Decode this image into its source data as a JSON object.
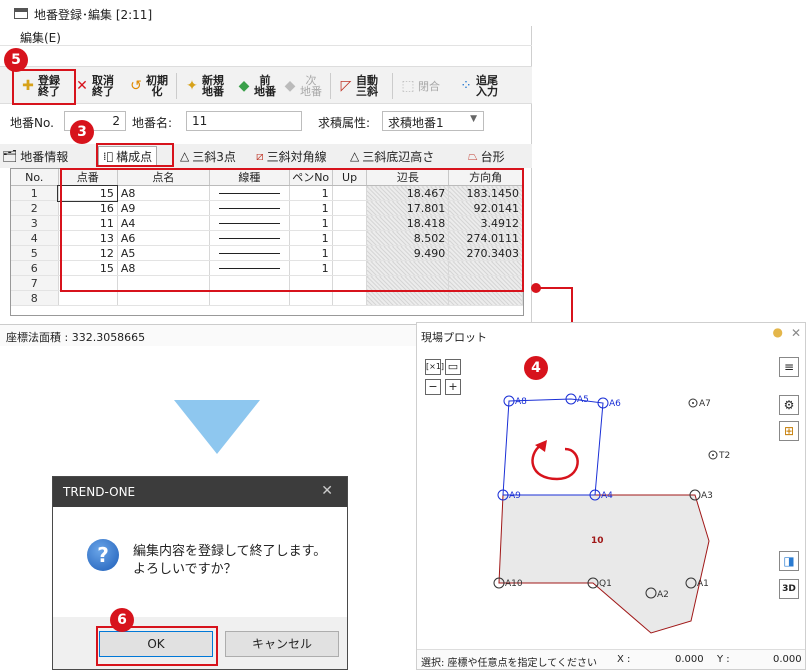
{
  "window": {
    "title": "地番登録･編集 [2:11]",
    "menu_edit": "編集(E)"
  },
  "toolbar": {
    "buttons": [
      {
        "label": "登録\n終了",
        "icon": "register-finish-icon"
      },
      {
        "label": "取消\n終了",
        "icon": "cancel-icon"
      },
      {
        "label": "初期\n化",
        "icon": "reset-icon"
      },
      {
        "label": "新規\n地番",
        "icon": "new-lot-icon"
      },
      {
        "label": "前\n地番",
        "icon": "prev-lot-icon"
      },
      {
        "label": "次\n地番",
        "icon": "next-lot-icon"
      },
      {
        "label": "自動\n三斜",
        "icon": "auto-triangle-icon"
      },
      {
        "label": "閉合",
        "icon": "close-polygon-icon"
      },
      {
        "label": "追尾\n入力",
        "icon": "trace-input-icon"
      }
    ]
  },
  "fields": {
    "lot_no_label": "地番No.",
    "lot_no_value": "2",
    "lot_name_label": "地番名:",
    "lot_name_value": "11",
    "attr_label": "求積属性:",
    "attr_value": "求積地番1"
  },
  "tabs": [
    "地番情報",
    "構成点",
    "三斜3点",
    "三斜対角線",
    "三斜底辺高さ",
    "台形"
  ],
  "grid": {
    "columns": [
      "No.",
      "点番",
      "点名",
      "線種",
      "ペンNo",
      "Up",
      "辺長",
      "方向角"
    ],
    "rows": [
      {
        "no": "1",
        "pt": "15",
        "name": "A8",
        "pen": "1",
        "len": "18.467",
        "dir": "183.1450"
      },
      {
        "no": "2",
        "pt": "16",
        "name": "A9",
        "pen": "1",
        "len": "17.801",
        "dir": "92.0141"
      },
      {
        "no": "3",
        "pt": "11",
        "name": "A4",
        "pen": "1",
        "len": "18.418",
        "dir": "3.4912"
      },
      {
        "no": "4",
        "pt": "13",
        "name": "A6",
        "pen": "1",
        "len": "8.502",
        "dir": "274.0111"
      },
      {
        "no": "5",
        "pt": "12",
        "name": "A5",
        "pen": "1",
        "len": "9.490",
        "dir": "270.3403"
      },
      {
        "no": "6",
        "pt": "15",
        "name": "A8",
        "pen": "1",
        "len": "",
        "dir": ""
      },
      {
        "no": "7",
        "pt": "",
        "name": "",
        "pen": "",
        "len": "",
        "dir": ""
      },
      {
        "no": "8",
        "pt": "",
        "name": "",
        "pen": "",
        "len": "",
        "dir": ""
      }
    ]
  },
  "status": {
    "area": "座標法面積 : 332.3058665"
  },
  "plot": {
    "title": "現場プロット",
    "zoom_label": "[×1]",
    "points": [
      "A8",
      "A5",
      "A6",
      "A7",
      "T2",
      "A9",
      "A4",
      "A3",
      "A10",
      "Q1",
      "A1",
      "A2"
    ],
    "parcel_label": "10",
    "status_text": "選択: 座標や任意点を指定してください",
    "x_label": "X :",
    "x_value": "0.000",
    "y_label": "Y :",
    "y_value": "0.000"
  },
  "dialog": {
    "title": "TREND-ONE",
    "message_line1": "編集内容を登録して終了します。",
    "message_line2": "よろしいですか？",
    "ok": "OK",
    "cancel": "キャンセル"
  },
  "callouts": {
    "step3": "3",
    "step4": "4",
    "step5": "5",
    "step6": "6"
  },
  "colors": {
    "accent_red": "#d7131c",
    "polygon_blue": "#1a2fd6",
    "polygon_red": "#a01818",
    "triangle": "#8ec7ef"
  }
}
